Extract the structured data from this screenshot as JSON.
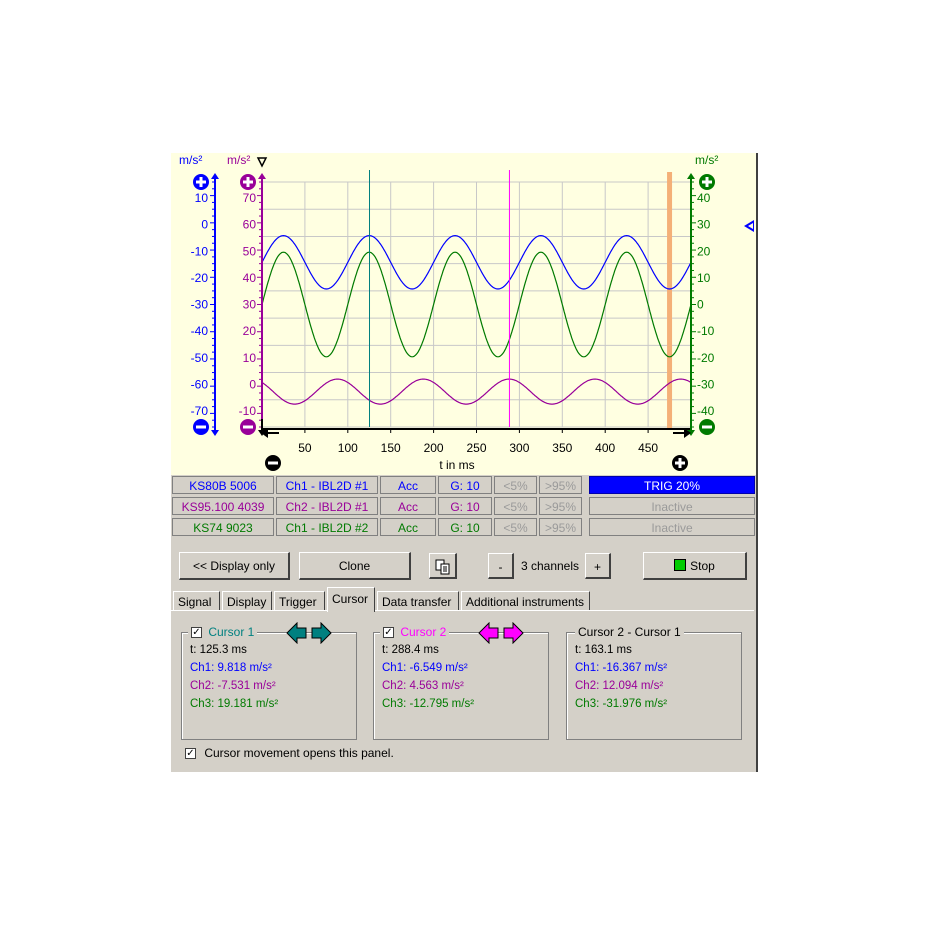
{
  "colors": {
    "ch1": "#0000ff",
    "ch2": "#990099",
    "ch3": "#007a00",
    "cursor1": "#008080",
    "cursor2": "#ff00ff",
    "trig_bg": "#0000ff",
    "trig_fg": "#ffffff",
    "plot_bg": "#ffffe1",
    "panel_bg": "#d4d0c8",
    "trigger_band": "#f4b078"
  },
  "scope": {
    "unit_left_outer": "m/s²",
    "unit_left_inner": "m/s²",
    "unit_right": "m/s²",
    "axis_left_outer_ticks": [
      "10",
      "0",
      "-10",
      "-20",
      "-30",
      "-40",
      "-50",
      "-60",
      "-70"
    ],
    "axis_left_inner_ticks": [
      "70",
      "60",
      "50",
      "40",
      "30",
      "20",
      "10",
      "0",
      "-10"
    ],
    "axis_right_ticks": [
      "40",
      "30",
      "20",
      "10",
      "0",
      "-10",
      "-20",
      "-30",
      "-40"
    ],
    "x_ticks": [
      "50",
      "100",
      "150",
      "200",
      "250",
      "300",
      "350",
      "400",
      "450"
    ],
    "xlabel": "t in ms",
    "icons": [
      "zoom-in-icon",
      "zoom-out-icon",
      "arrow-up-icon",
      "arrow-down-icon",
      "trigger-marker-icon",
      "scroll-left-icon",
      "scroll-right-icon",
      "trigger-level-icon"
    ]
  },
  "chart_data": {
    "type": "line",
    "xlabel": "t in ms",
    "xlim": [
      0,
      500
    ],
    "grid": true,
    "series": [
      {
        "axis": "left-outer",
        "color": "#0000ff",
        "ylim": [
          -75,
          15
        ],
        "shape": "sine",
        "offset": -14.5,
        "amplitude": 9.8,
        "period_ms": 100,
        "peak_t_ms": 125
      },
      {
        "axis": "left-inner",
        "color": "#990099",
        "ylim": [
          -15,
          75
        ],
        "shape": "sine",
        "offset": -2.0,
        "amplitude": 4.6,
        "period_ms": 100,
        "peak_t_ms": 88
      },
      {
        "axis": "right",
        "color": "#007a00",
        "ylim": [
          -45,
          45
        ],
        "shape": "sine",
        "offset": 0.0,
        "amplitude": 19.2,
        "period_ms": 100,
        "peak_t_ms": 125
      }
    ],
    "cursors": [
      {
        "name": "Cursor 1",
        "t_ms": 125.3,
        "color": "#008080"
      },
      {
        "name": "Cursor 2",
        "t_ms": 288.4,
        "color": "#ff00ff"
      }
    ],
    "trigger_t_ms": 475
  },
  "channels": [
    {
      "sensor": "KS80B 5006",
      "input": "Ch1 - IBL2D #1",
      "mode": "Acc",
      "gain": "G: 10",
      "low": "<5%",
      "high": ">95%",
      "status": "TRIG   20%",
      "color": "#0000ff",
      "active": true
    },
    {
      "sensor": "KS95.100 4039",
      "input": "Ch2 - IBL2D #1",
      "mode": "Acc",
      "gain": "G: 10",
      "low": "<5%",
      "high": ">95%",
      "status": "Inactive",
      "color": "#990099",
      "active": false
    },
    {
      "sensor": "KS74 9023",
      "input": "Ch1 - IBL2D #2",
      "mode": "Acc",
      "gain": "G: 10",
      "low": "<5%",
      "high": ">95%",
      "status": "Inactive",
      "color": "#007a00",
      "active": false
    }
  ],
  "toolbar": {
    "display_only": "<< Display only",
    "clone": "Clone",
    "copy_icon": "copy-icon",
    "minus": "-",
    "channels": "3 channels",
    "plus": "+",
    "stop": "Stop"
  },
  "tabs": [
    {
      "label": "Signal",
      "active": false
    },
    {
      "label": "Display",
      "active": false
    },
    {
      "label": "Trigger",
      "active": false
    },
    {
      "label": "Cursor",
      "active": true
    },
    {
      "label": "Data transfer",
      "active": false
    },
    {
      "label": "Additional instruments",
      "active": false
    }
  ],
  "cursor_panel": {
    "cursor1": {
      "title": "Cursor 1",
      "checked": true,
      "t": "t: 125.3 ms",
      "ch1": "Ch1: 9.818 m/s²",
      "ch2": "Ch2: -7.531 m/s²",
      "ch3": "Ch3: 19.181 m/s²"
    },
    "cursor2": {
      "title": "Cursor 2",
      "checked": true,
      "t": "t: 288.4 ms",
      "ch1": "Ch1: -6.549 m/s²",
      "ch2": "Ch2: 4.563 m/s²",
      "ch3": "Ch3: -12.795 m/s²"
    },
    "diff": {
      "title": "Cursor 2 - Cursor 1",
      "t": "t: 163.1 ms",
      "ch1": "Ch1: -16.367 m/s²",
      "ch2": "Ch2: 12.094 m/s²",
      "ch3": "Ch3: -31.976 m/s²"
    },
    "option_label": "Cursor movement opens this panel.",
    "option_checked": true
  }
}
